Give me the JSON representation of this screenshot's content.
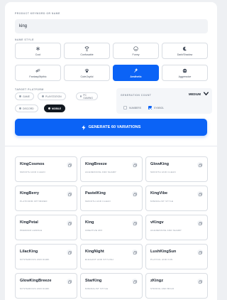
{
  "form": {
    "prompt_label": "PRODUCT KEYWORD OR NAME",
    "prompt_value": "king",
    "style_label": "NAME STYLE",
    "platform_label": "TARGET PLATFORM",
    "count_label": "GENERATION COUNT",
    "count_value": "MEDIUM"
  },
  "styles": [
    {
      "label": "Cool",
      "icon": "snowflake-icon"
    },
    {
      "label": "Confusable",
      "icon": "trophy-icon"
    },
    {
      "label": "Funny",
      "icon": "smile-icon"
    },
    {
      "label": "Dark/Shadow",
      "icon": "moon-icon"
    },
    {
      "label": "Fantasy/Mythic",
      "icon": "dragon-icon"
    },
    {
      "label": "Cute/Joyful",
      "icon": "paw-icon"
    },
    {
      "label": "Aesthetic",
      "icon": "sparkle-icon",
      "active": true
    },
    {
      "label": "Aggressive",
      "icon": "skull-icon"
    }
  ],
  "platforms": [
    {
      "label": "GAME"
    },
    {
      "label": "PLAYSTATION"
    },
    {
      "label": "PC GAMING"
    },
    {
      "label": "DISCORD"
    },
    {
      "label": "MOBILE",
      "active": true
    }
  ],
  "options": [
    {
      "label": "NUMBERS",
      "checked": false
    },
    {
      "label": "SYMBOL",
      "checked": true
    }
  ],
  "generate_button": "GENERATE 60 VARIATIONS",
  "results": [
    {
      "name": "KingCosmos",
      "desc": "SMOOTH AND CLEAN"
    },
    {
      "name": "KingBreeze",
      "desc": "AGGRESSIVE AND SHARP"
    },
    {
      "name": "GlowKing",
      "desc": "SMOOTH AND CLEAN"
    },
    {
      "name": "KingBerry",
      "desc": "PLATFORM OPTIMIZED"
    },
    {
      "name": "PastelKing",
      "desc": "SMOOTH AND CLEAN"
    },
    {
      "name": "KingVibe",
      "desc": "MINIMALIST STYLE"
    },
    {
      "name": "KingPetal",
      "desc": "PREMIUM HANDLE"
    },
    {
      "name": "King",
      "desc": "CREATIVE MIX"
    },
    {
      "name": "vKingv",
      "desc": "AGGRESSIVE AND SHARP"
    },
    {
      "name": "LilacKing",
      "desc": "MYSTERIOUS AND DARK"
    },
    {
      "name": "KingNight",
      "desc": "ELEGANT AND STYLISH"
    },
    {
      "name": "LushKingSun",
      "desc": "PLAYFUL AND FUN"
    },
    {
      "name": "GlowKingBreeze",
      "desc": "MYSTERIOUS AND DARK"
    },
    {
      "name": "StarKing",
      "desc": "MINIMALIST STYLE"
    },
    {
      "name": "zKingz",
      "desc": "STRONG AND BOLD"
    }
  ],
  "colors": {
    "accent": "#0b63f6",
    "dark_chip": "#121820"
  }
}
